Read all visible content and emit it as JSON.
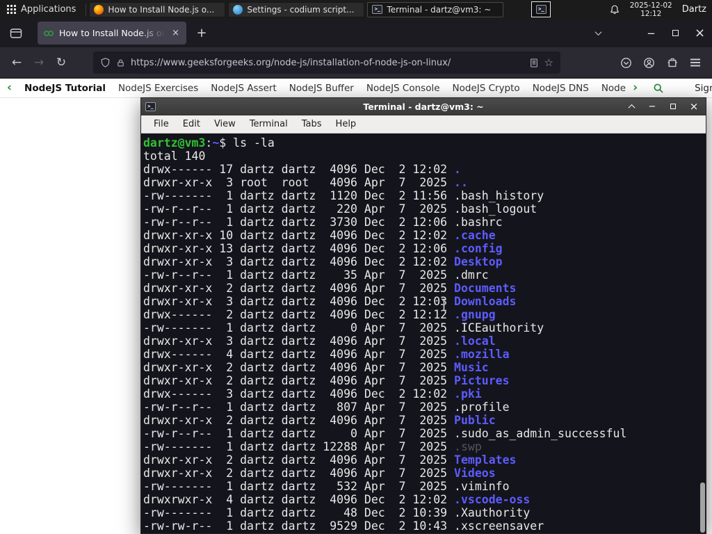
{
  "icons": {
    "back": "←",
    "forward": "→",
    "reload": "↻",
    "star": "☆",
    "close": "×",
    "new_tab": "+",
    "minimize": "−",
    "prompt_glyph": ">_"
  },
  "panel": {
    "applications": "Applications",
    "taskbar": [
      {
        "label": "How to Install Node.js o...",
        "icon": "firefox",
        "active": false
      },
      {
        "label": "Settings - codium script...",
        "icon": "codium",
        "active": false
      },
      {
        "label": "Terminal - dartz@vm3: ~",
        "icon": "terminal",
        "active": true
      }
    ],
    "date": "2025-12-02",
    "time": "12:12",
    "user": "Dartz"
  },
  "browser": {
    "active_tab": "How to Install Node.js on",
    "url": "https://www.geeksforgeeks.org/node-js/installation-of-node-js-on-linux/"
  },
  "sitenav": {
    "back": "‹",
    "forward": "›",
    "items": [
      "NodeJS Tutorial",
      "NodeJS Exercises",
      "NodeJS Assert",
      "NodeJS Buffer",
      "NodeJS Console",
      "NodeJS Crypto",
      "NodeJS DNS",
      "Node"
    ],
    "signin": "Sign In",
    "accent": "#2f8d46"
  },
  "terminal": {
    "title": "Terminal - dartz@vm3: ~",
    "menu": [
      "File",
      "Edit",
      "View",
      "Terminal",
      "Tabs",
      "Help"
    ],
    "prompt": {
      "user": "dartz@vm3",
      "sep": ":",
      "path": "~",
      "sigil": "$"
    },
    "command": "ls -la",
    "total": "total 140",
    "colors": {
      "background": "#14141c",
      "foreground": "#e8e8e8",
      "green": "#32c232",
      "blue": "#5c5cff",
      "dim": "#55555f"
    },
    "listing": [
      {
        "perms": "drwx------",
        "links": 17,
        "owner": "dartz",
        "group": "dartz",
        "size": 4096,
        "month": "Dec",
        "day": 2,
        "time": "12:02",
        "name": ".",
        "type": "dir"
      },
      {
        "perms": "drwxr-xr-x",
        "links": 3,
        "owner": "root",
        "group": "root",
        "size": 4096,
        "month": "Apr",
        "day": 7,
        "time": "2025",
        "name": "..",
        "type": "dir"
      },
      {
        "perms": "-rw-------",
        "links": 1,
        "owner": "dartz",
        "group": "dartz",
        "size": 1120,
        "month": "Dec",
        "day": 2,
        "time": "11:56",
        "name": ".bash_history",
        "type": "file"
      },
      {
        "perms": "-rw-r--r--",
        "links": 1,
        "owner": "dartz",
        "group": "dartz",
        "size": 220,
        "month": "Apr",
        "day": 7,
        "time": "2025",
        "name": ".bash_logout",
        "type": "file"
      },
      {
        "perms": "-rw-r--r--",
        "links": 1,
        "owner": "dartz",
        "group": "dartz",
        "size": 3730,
        "month": "Dec",
        "day": 2,
        "time": "12:06",
        "name": ".bashrc",
        "type": "file"
      },
      {
        "perms": "drwxr-xr-x",
        "links": 10,
        "owner": "dartz",
        "group": "dartz",
        "size": 4096,
        "month": "Dec",
        "day": 2,
        "time": "12:02",
        "name": ".cache",
        "type": "dir"
      },
      {
        "perms": "drwxr-xr-x",
        "links": 13,
        "owner": "dartz",
        "group": "dartz",
        "size": 4096,
        "month": "Dec",
        "day": 2,
        "time": "12:06",
        "name": ".config",
        "type": "dir"
      },
      {
        "perms": "drwxr-xr-x",
        "links": 3,
        "owner": "dartz",
        "group": "dartz",
        "size": 4096,
        "month": "Dec",
        "day": 2,
        "time": "12:02",
        "name": "Desktop",
        "type": "dir"
      },
      {
        "perms": "-rw-r--r--",
        "links": 1,
        "owner": "dartz",
        "group": "dartz",
        "size": 35,
        "month": "Apr",
        "day": 7,
        "time": "2025",
        "name": ".dmrc",
        "type": "file"
      },
      {
        "perms": "drwxr-xr-x",
        "links": 2,
        "owner": "dartz",
        "group": "dartz",
        "size": 4096,
        "month": "Apr",
        "day": 7,
        "time": "2025",
        "name": "Documents",
        "type": "dir"
      },
      {
        "perms": "drwxr-xr-x",
        "links": 3,
        "owner": "dartz",
        "group": "dartz",
        "size": 4096,
        "month": "Dec",
        "day": 2,
        "time": "12:03",
        "name": "Downloads",
        "type": "dir"
      },
      {
        "perms": "drwx------",
        "links": 2,
        "owner": "dartz",
        "group": "dartz",
        "size": 4096,
        "month": "Dec",
        "day": 2,
        "time": "12:12",
        "name": ".gnupg",
        "type": "dir"
      },
      {
        "perms": "-rw-------",
        "links": 1,
        "owner": "dartz",
        "group": "dartz",
        "size": 0,
        "month": "Apr",
        "day": 7,
        "time": "2025",
        "name": ".ICEauthority",
        "type": "file"
      },
      {
        "perms": "drwxr-xr-x",
        "links": 3,
        "owner": "dartz",
        "group": "dartz",
        "size": 4096,
        "month": "Apr",
        "day": 7,
        "time": "2025",
        "name": ".local",
        "type": "dir"
      },
      {
        "perms": "drwx------",
        "links": 4,
        "owner": "dartz",
        "group": "dartz",
        "size": 4096,
        "month": "Apr",
        "day": 7,
        "time": "2025",
        "name": ".mozilla",
        "type": "dir"
      },
      {
        "perms": "drwxr-xr-x",
        "links": 2,
        "owner": "dartz",
        "group": "dartz",
        "size": 4096,
        "month": "Apr",
        "day": 7,
        "time": "2025",
        "name": "Music",
        "type": "dir"
      },
      {
        "perms": "drwxr-xr-x",
        "links": 2,
        "owner": "dartz",
        "group": "dartz",
        "size": 4096,
        "month": "Apr",
        "day": 7,
        "time": "2025",
        "name": "Pictures",
        "type": "dir"
      },
      {
        "perms": "drwx------",
        "links": 3,
        "owner": "dartz",
        "group": "dartz",
        "size": 4096,
        "month": "Dec",
        "day": 2,
        "time": "12:02",
        "name": ".pki",
        "type": "dir"
      },
      {
        "perms": "-rw-r--r--",
        "links": 1,
        "owner": "dartz",
        "group": "dartz",
        "size": 807,
        "month": "Apr",
        "day": 7,
        "time": "2025",
        "name": ".profile",
        "type": "file"
      },
      {
        "perms": "drwxr-xr-x",
        "links": 2,
        "owner": "dartz",
        "group": "dartz",
        "size": 4096,
        "month": "Apr",
        "day": 7,
        "time": "2025",
        "name": "Public",
        "type": "dir"
      },
      {
        "perms": "-rw-r--r--",
        "links": 1,
        "owner": "dartz",
        "group": "dartz",
        "size": 0,
        "month": "Apr",
        "day": 7,
        "time": "2025",
        "name": ".sudo_as_admin_successful",
        "type": "file"
      },
      {
        "perms": "-rw-------",
        "links": 1,
        "owner": "dartz",
        "group": "dartz",
        "size": 12288,
        "month": "Apr",
        "day": 7,
        "time": "2025",
        "name": ".swp",
        "type": "dim"
      },
      {
        "perms": "drwxr-xr-x",
        "links": 2,
        "owner": "dartz",
        "group": "dartz",
        "size": 4096,
        "month": "Apr",
        "day": 7,
        "time": "2025",
        "name": "Templates",
        "type": "dir"
      },
      {
        "perms": "drwxr-xr-x",
        "links": 2,
        "owner": "dartz",
        "group": "dartz",
        "size": 4096,
        "month": "Apr",
        "day": 7,
        "time": "2025",
        "name": "Videos",
        "type": "dir"
      },
      {
        "perms": "-rw-------",
        "links": 1,
        "owner": "dartz",
        "group": "dartz",
        "size": 532,
        "month": "Apr",
        "day": 7,
        "time": "2025",
        "name": ".viminfo",
        "type": "file"
      },
      {
        "perms": "drwxrwxr-x",
        "links": 4,
        "owner": "dartz",
        "group": "dartz",
        "size": 4096,
        "month": "Dec",
        "day": 2,
        "time": "12:02",
        "name": ".vscode-oss",
        "type": "dir"
      },
      {
        "perms": "-rw-------",
        "links": 1,
        "owner": "dartz",
        "group": "dartz",
        "size": 48,
        "month": "Dec",
        "day": 2,
        "time": "10:39",
        "name": ".Xauthority",
        "type": "file"
      },
      {
        "perms": "-rw-rw-r--",
        "links": 1,
        "owner": "dartz",
        "group": "dartz",
        "size": 9529,
        "month": "Dec",
        "day": 2,
        "time": "10:43",
        "name": ".xscreensaver",
        "type": "file"
      }
    ]
  }
}
